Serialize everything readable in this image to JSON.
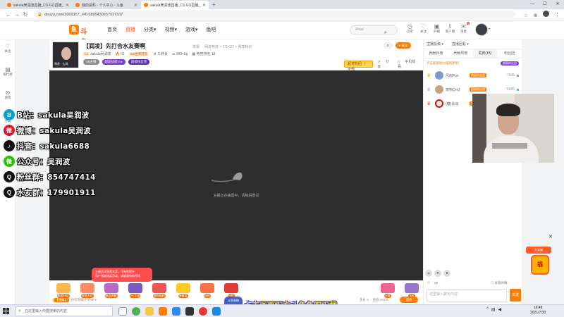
{
  "browser": {
    "tabs": [
      {
        "title": "sakula吴润波直播_CS:GO直播_",
        "active": false
      },
      {
        "title": "我的资料 - 个人中心 - 斗鱼",
        "active": false
      },
      {
        "title": "sakula吴润波直播_CS:GO直播_",
        "active": true
      }
    ],
    "url": "douyu.com/3069357_r=0.5895430657037337"
  },
  "header": {
    "logo_text": "斗鱼",
    "nav": [
      "首页",
      "直播",
      "分类▾",
      "视频▾",
      "游戏▾",
      "鱼吧"
    ],
    "active_nav": "直播",
    "search_placeholder": "Ahad",
    "icons": [
      {
        "label": "历史",
        "icon": "clock-icon"
      },
      {
        "label": "关注",
        "icon": "heart-icon"
      },
      {
        "label": "开播",
        "icon": "camera-icon"
      },
      {
        "label": "客户端",
        "icon": "download-icon"
      },
      {
        "label": "消息",
        "icon": "bell-icon",
        "badge": "1"
      }
    ]
  },
  "sidebar": [
    {
      "label": "关注",
      "icon": "heart-icon"
    },
    {
      "label": "排行榜",
      "icon": "rank-icon"
    },
    {
      "label": "游戏",
      "icon": "gamepad-icon"
    },
    {
      "label": "分类",
      "icon": "grid-icon"
    },
    {
      "label": "更多",
      "icon": "more-icon"
    }
  ],
  "room": {
    "title": "【润凌】先打合水友赛啊",
    "report": "举报",
    "category": "网游竞技 > CS:GO > 赛季特训",
    "cap_label": "熟悉 · 山岚",
    "streamer": "sakula吴润波",
    "level": "61",
    "tag1": "CS世界冠军",
    "fans": "三峡会",
    "weight": "999+kg",
    "rank": "电竞排名 18",
    "badge_v": "V8主播",
    "badge_p1": "超超战绩",
    "badge_p1_count": "0",
    "badge_p2": "超级粉丝团",
    "share_count": "0",
    "follow": "关注",
    "banner": "超宠粉团 丨 全部",
    "share": "分享",
    "phone": "手机观看"
  },
  "video": {
    "loading_text": "主播正在抽烟中，请稍后重试"
  },
  "social": [
    {
      "icon": "bilibili-icon",
      "color": "#00a1d6",
      "glyph": "B",
      "text": "B站：sakula吴润波"
    },
    {
      "icon": "weibo-icon",
      "color": "#e6162d",
      "glyph": "微",
      "text": "微博：sakula吴润波"
    },
    {
      "icon": "douyin-icon",
      "color": "#111111",
      "glyph": "♪",
      "text": "抖音：sakula6688"
    },
    {
      "icon": "wechat-icon",
      "color": "#2dc100",
      "glyph": "微",
      "text": "公众号：吴润波"
    },
    {
      "icon": "qq-icon",
      "color": "#111111",
      "glyph": "Q",
      "text": "粉丝群：854747414"
    },
    {
      "icon": "qq-icon-2",
      "color": "#111111",
      "glyph": "Q",
      "text": "水友群：179901911"
    }
  ],
  "gifts": [
    {
      "label": "能量狂欢",
      "color": "#ffb74d"
    },
    {
      "label": "抖鱼大会",
      "color": "#ff8a65"
    },
    {
      "label": "来点弹幕",
      "color": "#ba68c8"
    },
    {
      "label": "PK互动",
      "color": "#7e57c2"
    },
    {
      "label": "超粉福利",
      "color": "#ef5350"
    },
    {
      "label": "弹幕奖",
      "color": "#ffca28"
    },
    {
      "label": "超神",
      "color": "#ff7043"
    },
    {
      "label": "狂热",
      "color": "#e53935"
    }
  ],
  "gifts_right": [
    {
      "label": "火箭",
      "color": "#f06292"
    },
    {
      "label": "飞机",
      "color": "#9575cd"
    }
  ],
  "giftbar": {
    "tag": "【通知】",
    "notice": "你可领取大奖SKY",
    "stat1": "鱼丸 0",
    "stat2": "鱼翅 303.0",
    "pay": "充值"
  },
  "toast": {
    "line1": "主播比试免费大奖，可有你提升",
    "line2": "用户领取抽奖活动，请留意你的时间"
  },
  "chat": {
    "top": [
      "主播投稿 ▾",
      "直播回看 ▾"
    ],
    "tabs": [
      "贡献日榜",
      "贡献周榜",
      "贵宾(15)",
      "粉丝团"
    ],
    "active_tab": "贵宾(15)",
    "notice": "点击超级助力/超粉特权",
    "notice_btn": "超级粉丝团",
    "ranks": [
      {
        "name": "风雨Fun",
        "lv": "超级粉丝团",
        "score": "7935"
      },
      {
        "name": "宠物QnQ",
        "lv": "超级粉丝团",
        "score": "5585"
      },
      {
        "name": "(糖)比派",
        "lv": "超级粉丝团",
        "score": ""
      }
    ],
    "input_placeholder": "这里输入聊天内容",
    "send": "发送",
    "shield": "屏蔽弹幕"
  },
  "float": {
    "top": "开宝箱",
    "box": "福"
  },
  "overlay": {
    "mascot": "斗鱼直播",
    "subtitle": "点击画面下方斗鱼鱼吧下载"
  },
  "taskbar": {
    "search_placeholder": "在这里输入你要搜索的内容",
    "time": "16:48",
    "date": "2021/7/30"
  }
}
